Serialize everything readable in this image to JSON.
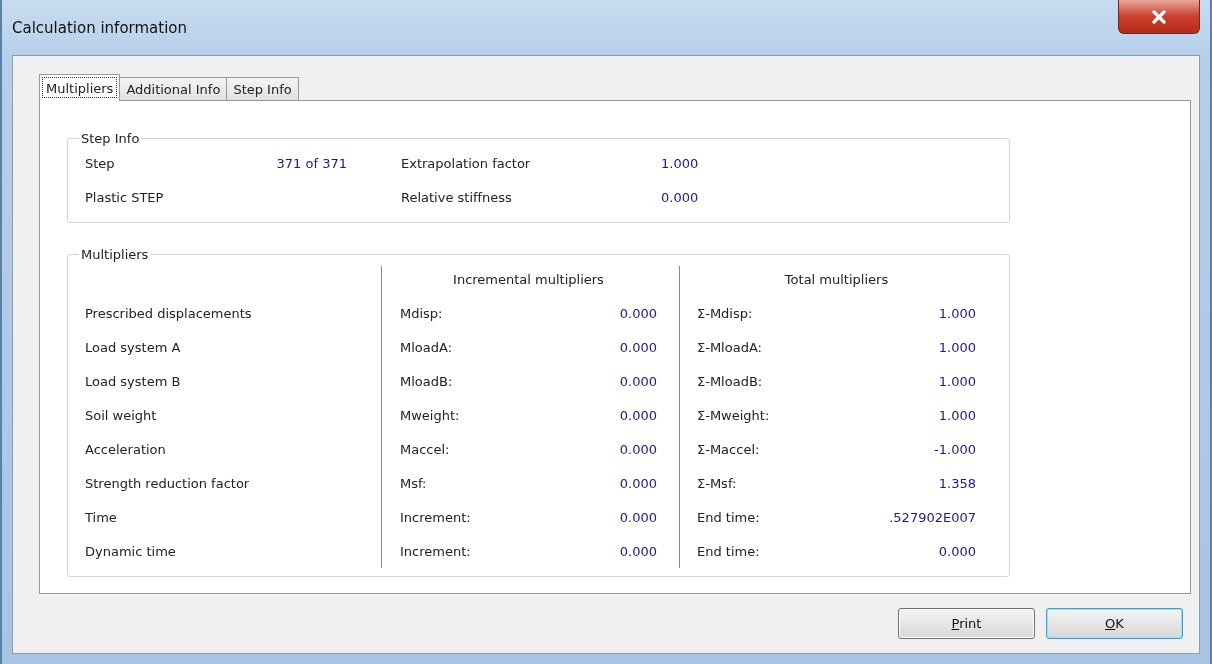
{
  "window": {
    "title": "Calculation information"
  },
  "tabs": [
    {
      "label": "Multipliers",
      "selected": true
    },
    {
      "label": "Additional Info",
      "selected": false
    },
    {
      "label": "Step Info",
      "selected": false
    }
  ],
  "step_info": {
    "title": "Step Info",
    "rows": [
      {
        "label": "Step",
        "value": "371 of 371",
        "label_2": "Extrapolation factor",
        "value_2": "1.000"
      },
      {
        "label": "Plastic STEP",
        "label_2": "Relative stiffness",
        "value_2": "0.000"
      }
    ]
  },
  "multipliers": {
    "title": "Multipliers",
    "incremental_header": "Incremental multipliers",
    "total_header": "Total multipliers",
    "rows": [
      {
        "label": "Prescribed displacements",
        "inc_label": "Mdisp:",
        "inc_value": "0.000",
        "total_label": "Σ-Mdisp:",
        "total_value": "1.000"
      },
      {
        "label": "Load system A",
        "inc_label": "MloadA:",
        "inc_value": "0.000",
        "total_label": "Σ-MloadA:",
        "total_value": "1.000"
      },
      {
        "label": "Load system B",
        "inc_label": "MloadB:",
        "inc_value": "0.000",
        "total_label": "Σ-MloadB:",
        "total_value": "1.000"
      },
      {
        "label": "Soil weight",
        "inc_label": "Mweight:",
        "inc_value": "0.000",
        "total_label": "Σ-Mweight:",
        "total_value": "1.000"
      },
      {
        "label": "Acceleration",
        "inc_label": "Maccel:",
        "inc_value": "0.000",
        "total_label": "Σ-Maccel:",
        "total_value": "-1.000"
      },
      {
        "label": "Strength reduction factor",
        "inc_label": "Msf:",
        "inc_value": "0.000",
        "total_label": "Σ-Msf:",
        "total_value": "1.358"
      },
      {
        "label": "Time",
        "inc_label": "Increment:",
        "inc_value": "0.000",
        "total_label": "End time:",
        "total_value": ".527902E007"
      },
      {
        "label": "Dynamic time",
        "inc_label": "Increment:",
        "inc_value": "0.000",
        "total_label": "End time:",
        "total_value": "0.000"
      }
    ]
  },
  "buttons": [
    {
      "label": "Print",
      "default": false
    },
    {
      "label": "OK",
      "default": true
    }
  ]
}
